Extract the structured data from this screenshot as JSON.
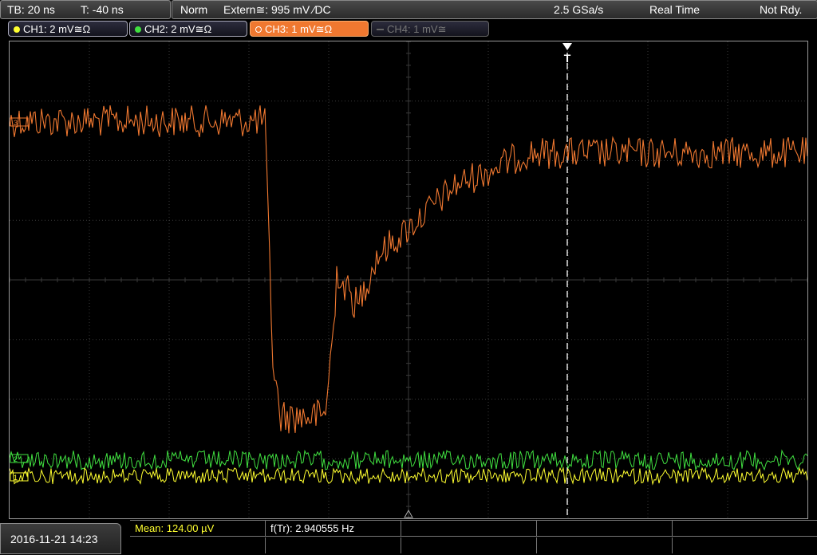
{
  "topbar": {
    "timebase": "TB: 20 ns",
    "trigger_offset": "T: -40 ns",
    "mode": "Norm",
    "trigger_source": "Extern≅: 995 mV ⁄DC",
    "sample_rate": "2.5 GSa/s",
    "acq_mode": "Real Time",
    "status": "Not Rdy."
  },
  "channels": [
    {
      "label": "CH1: 2 mV≅Ω",
      "color": "#ffff30",
      "state": "on"
    },
    {
      "label": "CH2: 2 mV≅Ω",
      "color": "#40e040",
      "state": "on"
    },
    {
      "label": "CH3: 1 mV≅Ω",
      "color": "#f07830",
      "state": "active"
    },
    {
      "label": "CH4: 1 mV≅",
      "color": "#888888",
      "state": "off"
    }
  ],
  "markers": {
    "ch3": "3",
    "ch1": "1",
    "ch2": "2",
    "trigger": "T"
  },
  "datetime": "2016-11-21 14:23",
  "measurements": {
    "mean": "Mean: 124.00 µV",
    "freq": "f(Tr): 2.940555 Hz"
  },
  "colors": {
    "ch1": "#ffff30",
    "ch2": "#40e040",
    "ch3": "#f07830",
    "grid": "#3a3a3a"
  }
}
